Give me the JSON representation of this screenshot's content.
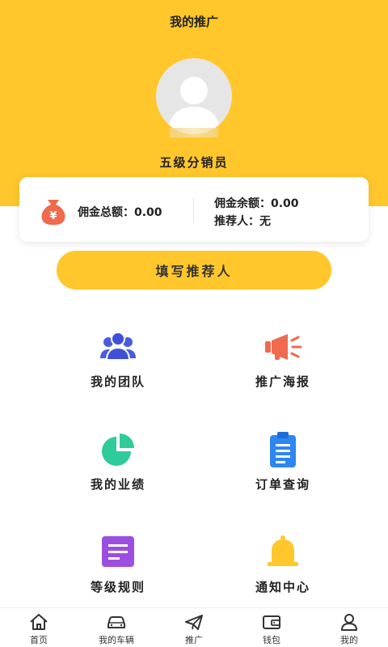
{
  "header": {
    "title": "我的推广",
    "level": "五级分销员"
  },
  "commission": {
    "total_label": "佣金总额：",
    "total_value": "0.00",
    "balance_label": "佣金余额：",
    "balance_value": "0.00",
    "referrer_label": "推荐人：",
    "referrer_value": "无",
    "icon_symbol": "¥"
  },
  "fill_referrer_button": "填写推荐人",
  "grid": [
    {
      "label": "我的团队",
      "icon": "team-icon",
      "color": "#4A5BE0"
    },
    {
      "label": "推广海报",
      "icon": "megaphone-icon",
      "color": "#F06A4E"
    },
    {
      "label": "我的业绩",
      "icon": "pie-chart-icon",
      "color": "#2FCB9A"
    },
    {
      "label": "订单查询",
      "icon": "clipboard-icon",
      "color": "#2E86F2"
    },
    {
      "label": "等级规则",
      "icon": "list-icon",
      "color": "#9B4FE0"
    },
    {
      "label": "通知中心",
      "icon": "bell-icon",
      "color": "#FFC72C"
    }
  ],
  "tabs": [
    {
      "label": "首页",
      "icon": "home-icon"
    },
    {
      "label": "我的车辆",
      "icon": "car-icon"
    },
    {
      "label": "推广",
      "icon": "paper-plane-icon"
    },
    {
      "label": "钱包",
      "icon": "wallet-icon"
    },
    {
      "label": "我的",
      "icon": "user-icon"
    }
  ],
  "colors": {
    "brand_yellow": "#FFC72C",
    "money_red": "#F06A4E"
  }
}
